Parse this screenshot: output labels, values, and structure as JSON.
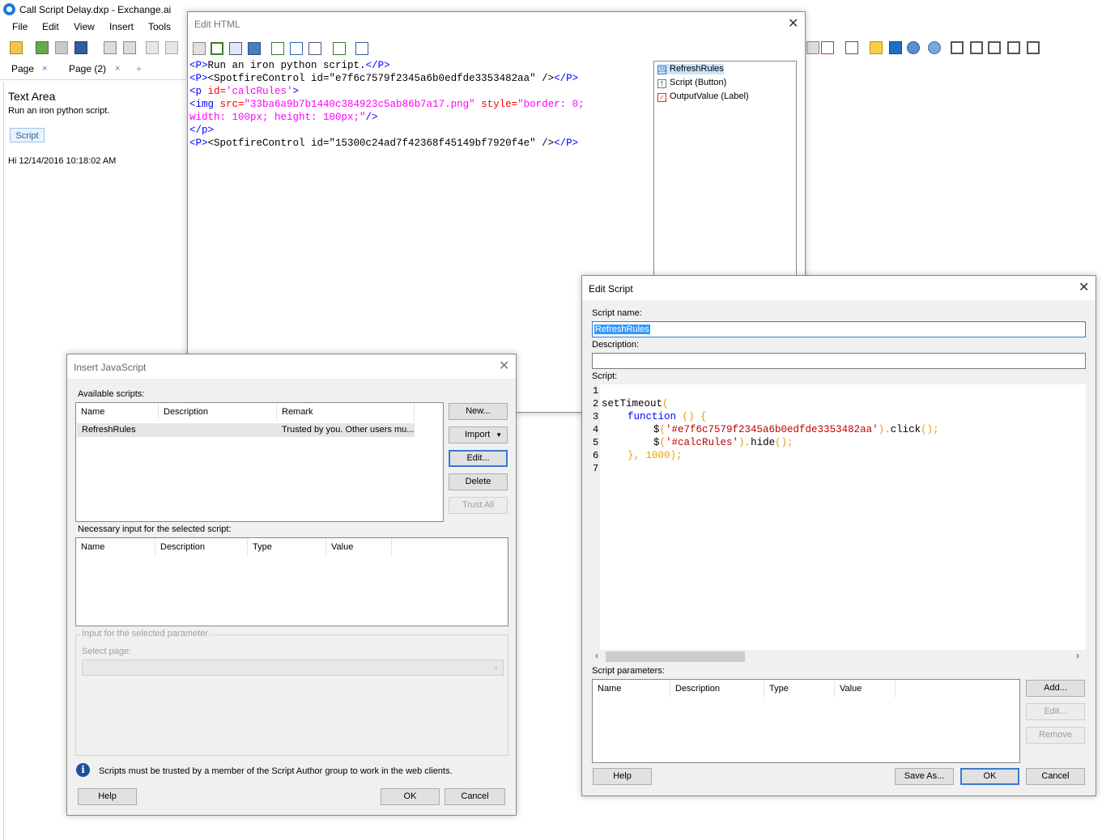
{
  "app": {
    "title": "Call Script Delay.dxp - Exchange.ai"
  },
  "menu": [
    "File",
    "Edit",
    "View",
    "Insert",
    "Tools"
  ],
  "tabs": [
    {
      "label": "Page",
      "close": "×"
    },
    {
      "label": "Page (2)",
      "close": "×"
    },
    {
      "label": "+"
    }
  ],
  "page": {
    "text_area_title": "Text Area",
    "text_area_desc": "Run an iron python script.",
    "script_button": "Script",
    "hi_text": "Hi 12/14/2016 10:18:02 AM"
  },
  "edit_html": {
    "title": "Edit HTML",
    "close": "✕",
    "code": {
      "l1_a": "<P>",
      "l1_b": "Run an iron python script.",
      "l1_c": "</P>",
      "l2_a": "<P>",
      "l2_b": "<SpotfireControl id=\"e7f6c7579f2345a6b0edfde3353482aa\" />",
      "l2_c": "</P>",
      "l3_a": "<p ",
      "l3_b": "id=",
      "l3_c": "'calcRules'",
      "l3_d": ">",
      "l4_a": "<img ",
      "l4_b": "src=",
      "l4_c": "\"33ba6a9b7b1440c384923c5ab86b7a17.png\"",
      "l4_d": " style=",
      "l4_e": "\"border: 0;",
      "l5_a": "width: 100px; height: 100px;\"",
      "l5_b": "/>",
      "l6_a": "</p>",
      "l7_a": "<P>",
      "l7_b": "<SpotfireControl id=\"15300c24ad7f42368f45149bf7920f4e\" />",
      "l7_c": "</P>"
    },
    "list": [
      {
        "label": "RefreshRules",
        "icon": "js-icon"
      },
      {
        "label": "Script (Button)",
        "icon": "button-icon"
      },
      {
        "label": "OutputValue (Label)",
        "icon": "label-icon"
      }
    ]
  },
  "insert_js": {
    "title": "Insert JavaScript",
    "close": "✕",
    "available_label": "Available scripts:",
    "columns": [
      "Name",
      "Description",
      "Remark"
    ],
    "rows": [
      {
        "name": "RefreshRules",
        "description": "",
        "remark": "Trusted by you. Other users mu..."
      }
    ],
    "buttons": {
      "new": "New...",
      "import": "Import",
      "edit": "Edit...",
      "delete": "Delete",
      "trust_all": "Trust All"
    },
    "necessary_label": "Necessary input for the selected script:",
    "param_columns": [
      "Name",
      "Description",
      "Type",
      "Value"
    ],
    "input_group_label": "Input for the selected parameter",
    "select_page_label": "Select page:",
    "info_text": "Scripts must be trusted by a member of the Script Author group to work in the web clients.",
    "help": "Help",
    "ok": "OK",
    "cancel": "Cancel"
  },
  "edit_script": {
    "title": "Edit Script",
    "close": "✕",
    "script_name_label": "Script name:",
    "script_name_value": "RefreshRules",
    "description_label": "Description:",
    "description_value": "",
    "script_label": "Script:",
    "line_numbers": [
      "1",
      "2",
      "3",
      "4",
      "5",
      "6",
      "7"
    ],
    "code": {
      "l2_a": "setTimeout",
      "l2_b": "(",
      "l3_a": "function",
      "l3_b": "() {",
      "l4_a": "$",
      "l4_b": "(",
      "l4_c": "'#e7f6c7579f2345a6b0edfde3353482aa'",
      "l4_d": ").",
      "l4_e": "click",
      "l4_f": "();",
      "l5_a": "$",
      "l5_b": "(",
      "l5_c": "'#calcRules'",
      "l5_d": ").",
      "l5_e": "hide",
      "l5_f": "();",
      "l6_a": "}, ",
      "l6_b": "1000",
      "l6_c": ");"
    },
    "params_label": "Script parameters:",
    "param_columns": [
      "Name",
      "Description",
      "Type",
      "Value"
    ],
    "buttons": {
      "add": "Add...",
      "edit": "Edit...",
      "remove": "Remove",
      "help": "Help",
      "save_as": "Save As...",
      "ok": "OK",
      "cancel": "Cancel"
    }
  },
  "colors": {
    "accent": "#3a78d4",
    "selection": "#3399ff",
    "keyword": "#0000ff",
    "string": "#c00000",
    "number": "#e6a000"
  }
}
